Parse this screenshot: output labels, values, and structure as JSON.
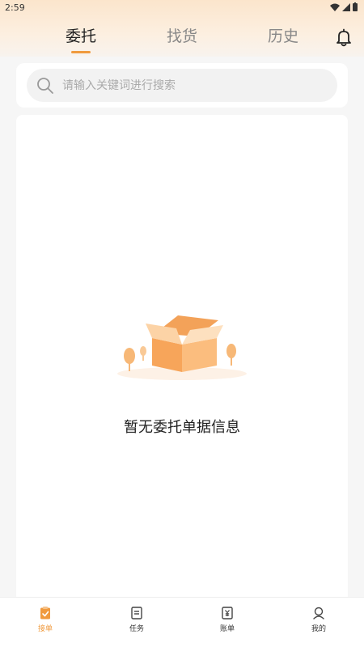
{
  "status_bar": {
    "time": "2:59"
  },
  "tabs": [
    {
      "label": "委托",
      "active": true
    },
    {
      "label": "找货",
      "active": false
    },
    {
      "label": "历史",
      "active": false
    }
  ],
  "search": {
    "placeholder": "请输入关键词进行搜索",
    "value": ""
  },
  "empty_state": {
    "message": "暂无委托单据信息"
  },
  "bottom_nav": [
    {
      "label": "接单",
      "icon": "clipboard-check-icon",
      "active": true
    },
    {
      "label": "任务",
      "icon": "task-list-icon",
      "active": false
    },
    {
      "label": "账单",
      "icon": "bill-yen-icon",
      "active": false
    },
    {
      "label": "我的",
      "icon": "profile-icon",
      "active": false
    }
  ],
  "colors": {
    "accent": "#f09a3e",
    "header_bg": "#fbe5cc",
    "page_bg": "#f6f6f6"
  }
}
